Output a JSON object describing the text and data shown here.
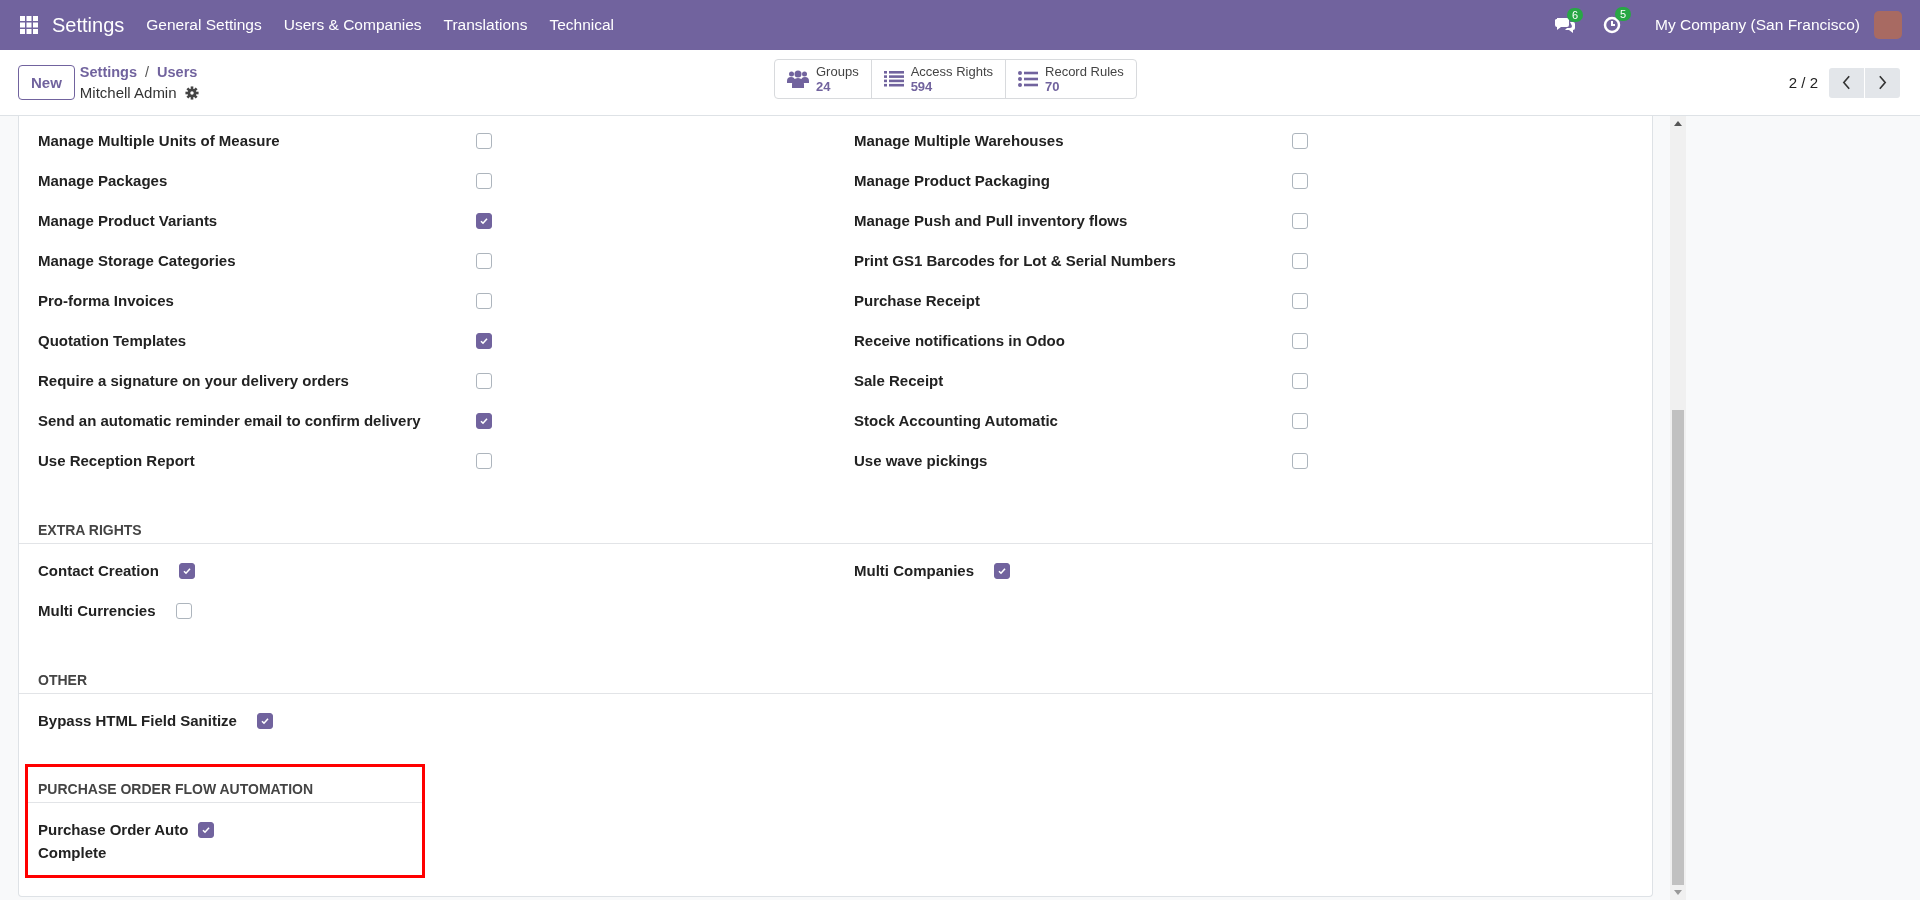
{
  "navbar": {
    "app": "Settings",
    "menu": [
      "General Settings",
      "Users & Companies",
      "Translations",
      "Technical"
    ],
    "messages_count": "6",
    "activities_count": "5",
    "company": "My Company (San Francisco)"
  },
  "control_panel": {
    "new_button": "New",
    "breadcrumb": [
      "Settings",
      "Users"
    ],
    "breadcrumb_separator": "/",
    "record": "Mitchell Admin",
    "pager": "2 / 2",
    "stat_buttons": [
      {
        "kind": "groups",
        "label": "Groups",
        "value": "24"
      },
      {
        "kind": "list",
        "label": "Access Rights",
        "value": "594"
      },
      {
        "kind": "bullets",
        "label": "Record Rules",
        "value": "70"
      }
    ]
  },
  "sections": [
    {
      "kind": "columns",
      "highlighted": false,
      "fields": [
        {
          "label": "Manage Multiple Units of Measure",
          "checked": false
        },
        {
          "label": "Manage Multiple Warehouses",
          "checked": false
        },
        {
          "label": "Manage Packages",
          "checked": false
        },
        {
          "label": "Manage Product Packaging",
          "checked": false
        },
        {
          "label": "Manage Product Variants",
          "checked": true
        },
        {
          "label": "Manage Push and Pull inventory flows",
          "checked": false
        },
        {
          "label": "Manage Storage Categories",
          "checked": false
        },
        {
          "label": "Print GS1 Barcodes for Lot & Serial Numbers",
          "checked": false
        },
        {
          "label": "Pro-forma Invoices",
          "checked": false
        },
        {
          "label": "Purchase Receipt",
          "checked": false
        },
        {
          "label": "Quotation Templates",
          "checked": true
        },
        {
          "label": "Receive notifications in Odoo",
          "checked": false
        },
        {
          "label": "Require a signature on your delivery orders",
          "checked": false
        },
        {
          "label": "Sale Receipt",
          "checked": false
        },
        {
          "label": "Send an automatic reminder email to confirm delivery",
          "checked": true
        },
        {
          "label": "Stock Accounting Automatic",
          "checked": false
        },
        {
          "label": "Use Reception Report",
          "checked": false
        },
        {
          "label": "Use wave pickings",
          "checked": false
        }
      ]
    },
    {
      "kind": "inline",
      "heading": "EXTRA RIGHTS",
      "highlighted": false,
      "fields": [
        {
          "label": "Contact Creation",
          "checked": true
        },
        {
          "label": "Multi Companies",
          "checked": true
        },
        {
          "label": "Multi Currencies",
          "checked": false
        }
      ]
    },
    {
      "kind": "inline",
      "heading": "OTHER",
      "highlighted": false,
      "fields": [
        {
          "label": "Bypass HTML Field Sanitize",
          "checked": true
        }
      ]
    },
    {
      "kind": "narrow",
      "heading": "PURCHASE ORDER FLOW AUTOMATION",
      "highlighted": true,
      "fields": [
        {
          "label": "Purchase Order Auto Complete",
          "checked": true
        }
      ]
    }
  ]
}
